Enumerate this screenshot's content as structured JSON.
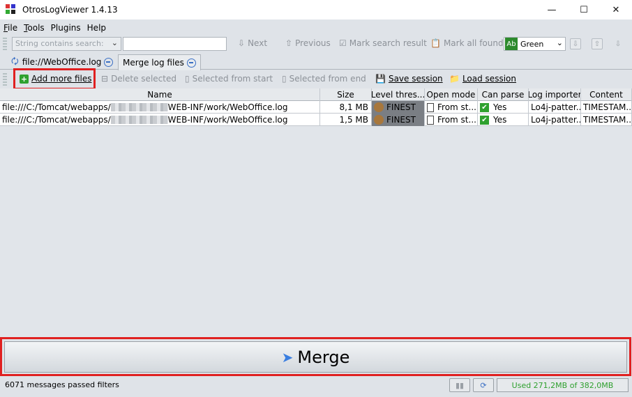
{
  "window": {
    "title": "OtrosLogViewer 1.4.13",
    "controls": {
      "minimize": "—",
      "maximize": "☐",
      "close": "✕"
    }
  },
  "menu": [
    {
      "label": "File",
      "underline": "F",
      "rest": "ile"
    },
    {
      "label": "Tools",
      "underline": "T",
      "rest": "ools"
    },
    {
      "label": "Plugins",
      "underline": "",
      "rest": "Plugins"
    },
    {
      "label": "Help",
      "underline": "",
      "rest": "Help"
    }
  ],
  "search": {
    "mode_placeholder": "String contains search:",
    "next": "Next",
    "previous": "Previous",
    "mark_search_result": "Mark search result",
    "mark_all_found": "Mark all found",
    "color_value": "Green",
    "color_swatch_text": "Ab",
    "accent_color": "#2c8a2c"
  },
  "tabs": [
    {
      "label": "file://WebOffice.log",
      "icon": "log-file-icon"
    },
    {
      "label": "Merge log files",
      "icon": "none"
    }
  ],
  "actions": {
    "add_more_files": "Add more files",
    "delete_selected": "Delete selected",
    "selected_from_start": "Selected from start",
    "selected_from_end": "Selected from end",
    "save_session": "Save session",
    "load_session": "Load session"
  },
  "table": {
    "columns": [
      "Name",
      "Size",
      "Level thres...",
      "Open mode",
      "Can parse",
      "Log importer",
      "Content"
    ],
    "rows": [
      {
        "name_prefix": "file:///C:/Tomcat/webapps/",
        "name_suffix": "WEB-INF/work/WebOffice.log",
        "size": "8,1 MB",
        "level": "FINEST",
        "open_mode": "From st...",
        "can_parse": "Yes",
        "importer": "Lo4j-patter...",
        "content": "TIMESTAM..."
      },
      {
        "name_prefix": "file:///C:/Tomcat/webapps/",
        "name_suffix": "WEB-INF/work/WebOffice.log",
        "size": "1,5 MB",
        "level": "FINEST",
        "open_mode": "From st...",
        "can_parse": "Yes",
        "importer": "Lo4j-patter...",
        "content": "TIMESTAM..."
      }
    ]
  },
  "merge_button": "Merge",
  "status": {
    "messages": "6071 messages passed filters",
    "memory": "Used 271,2MB of 382,0MB",
    "memory_color": "#2ea02e"
  },
  "highlight_color": "#e02020"
}
